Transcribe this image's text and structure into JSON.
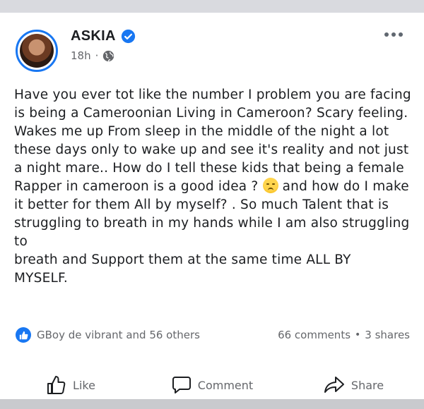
{
  "post": {
    "author": "ASKIA",
    "verified": true,
    "time": "18h",
    "audience_icon": "globe-icon",
    "text_lines": [
      "Have you ever tot like the number I problem you are facing",
      "is being a Cameroonian Living in Cameroon? Scary feeling.",
      "Wakes me up From sleep in the middle of the night a lot",
      "these days only to wake up and see it's reality and not  just",
      "a night mare.. How do I tell these kids that being a female",
      "Rapper in cameroon is a good idea ?",
      "and how do I make",
      "it better for them All by myself? . So much Talent that is",
      "struggling to breath in my hands while I am also struggling to",
      "breath  and Support them at the same time ALL BY",
      "MYSELF."
    ],
    "emoji": "disappointed-face-emoji"
  },
  "stats": {
    "reactions_text": "GBoy de vibrant and 56 others",
    "comments": "66 comments",
    "separator": "•",
    "shares": "3 shares"
  },
  "actions": {
    "like": "Like",
    "comment": "Comment",
    "share": "Share"
  },
  "colors": {
    "brand_blue": "#1877f2",
    "text": "#1c1e21",
    "muted": "#65676b"
  }
}
